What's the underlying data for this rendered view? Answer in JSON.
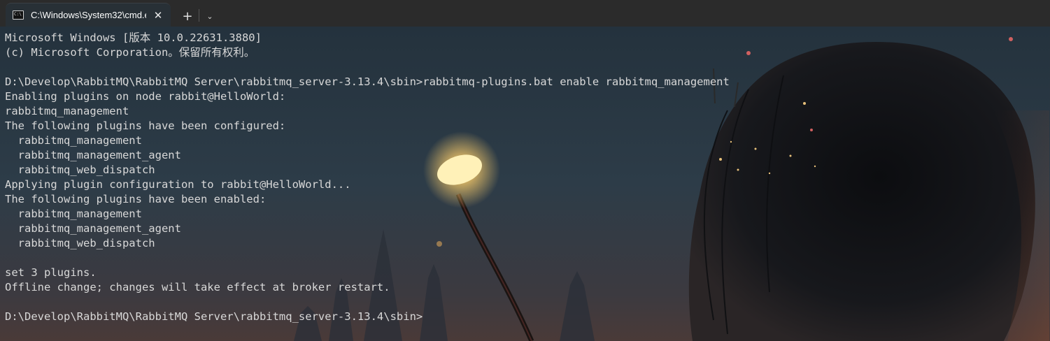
{
  "tab": {
    "title": "C:\\Windows\\System32\\cmd.e",
    "icon": "cmd-icon",
    "close_icon": "close-icon",
    "new_tab_label": "+",
    "dropdown_label": "⌄"
  },
  "terminal": {
    "lines": [
      "Microsoft Windows [版本 10.0.22631.3880]",
      "(c) Microsoft Corporation。保留所有权利。",
      "",
      "D:\\Develop\\RabbitMQ\\RabbitMQ Server\\rabbitmq_server-3.13.4\\sbin>rabbitmq-plugins.bat enable rabbitmq_management",
      "Enabling plugins on node rabbit@HelloWorld:",
      "rabbitmq_management",
      "The following plugins have been configured:",
      "  rabbitmq_management",
      "  rabbitmq_management_agent",
      "  rabbitmq_web_dispatch",
      "Applying plugin configuration to rabbit@HelloWorld...",
      "The following plugins have been enabled:",
      "  rabbitmq_management",
      "  rabbitmq_management_agent",
      "  rabbitmq_web_dispatch",
      "",
      "set 3 plugins.",
      "Offline change; changes will take effect at broker restart.",
      "",
      "D:\\Develop\\RabbitMQ\\RabbitMQ Server\\rabbitmq_server-3.13.4\\sbin>"
    ]
  },
  "colors": {
    "tabbar": "#2b2b2b",
    "tab_active": "#283036",
    "terminal_text": "#d8d8d8"
  }
}
